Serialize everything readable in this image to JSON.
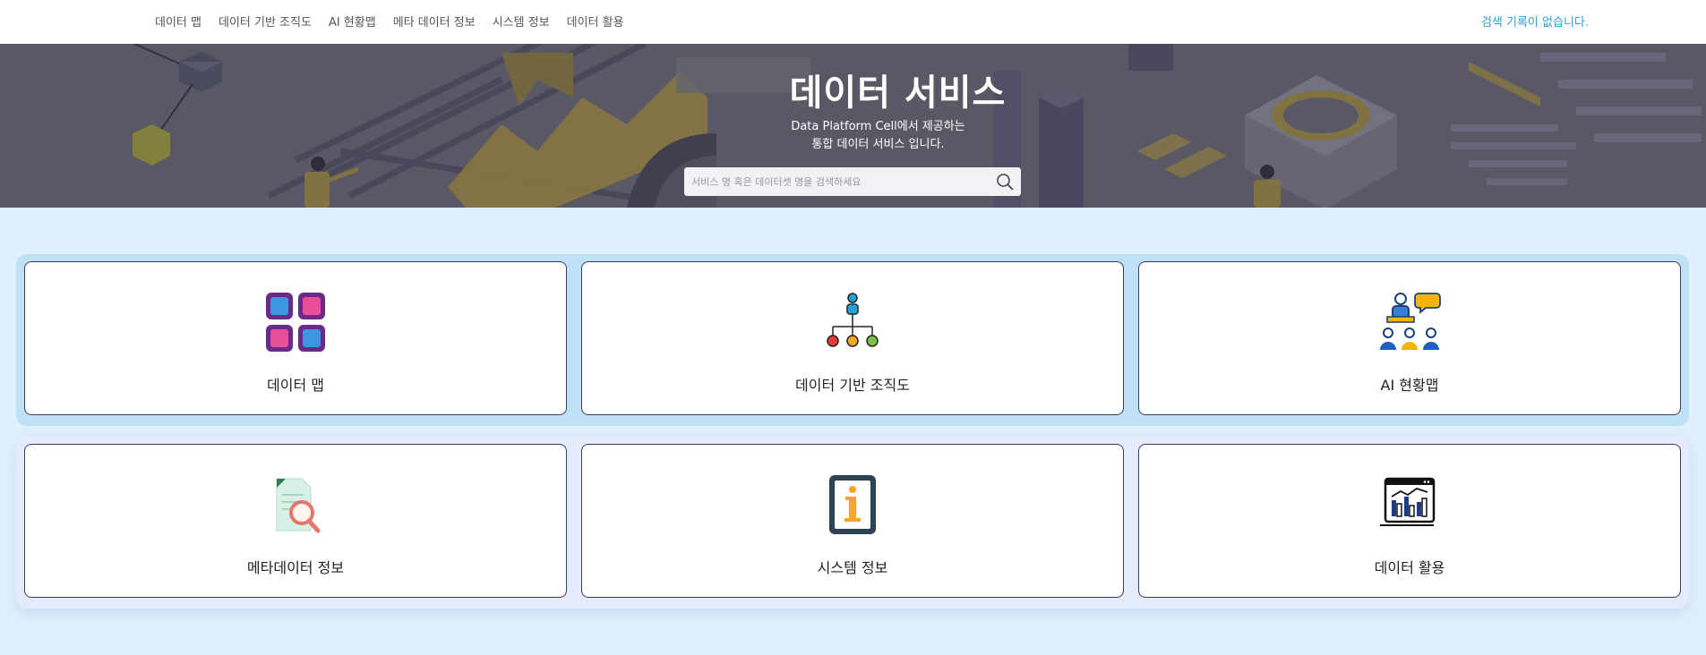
{
  "nav": {
    "items": [
      {
        "label": "데이터 맵"
      },
      {
        "label": "데이터 기반 조직도"
      },
      {
        "label": "AI 현황맵"
      },
      {
        "label": "메타 데이터 정보"
      },
      {
        "label": "시스템 정보"
      },
      {
        "label": "데이터 활용"
      }
    ],
    "search_history": "검색 기록이 없습니다."
  },
  "hero": {
    "title": "데이터 서비스",
    "subtitle_line1": "Data Platform Cell에서 제공하는",
    "subtitle_line2": "통합 데이터 서비스 입니다.",
    "search_placeholder": "서비스 명 혹은 데이터셋 명을 검색하세요"
  },
  "cards": [
    {
      "label": "데이터 맵",
      "icon": "grid-apps-icon"
    },
    {
      "label": "데이터 기반 조직도",
      "icon": "org-chart-icon"
    },
    {
      "label": "AI 현황맵",
      "icon": "team-chat-icon"
    },
    {
      "label": "메타데이터 정보",
      "icon": "document-search-icon"
    },
    {
      "label": "시스템 정보",
      "icon": "info-icon"
    },
    {
      "label": "데이터 활용",
      "icon": "analytics-chart-icon"
    }
  ],
  "colors": {
    "accent": "#2a9fd6",
    "main_bg": "#dff0fc",
    "card_border": "#3c3c5a"
  }
}
